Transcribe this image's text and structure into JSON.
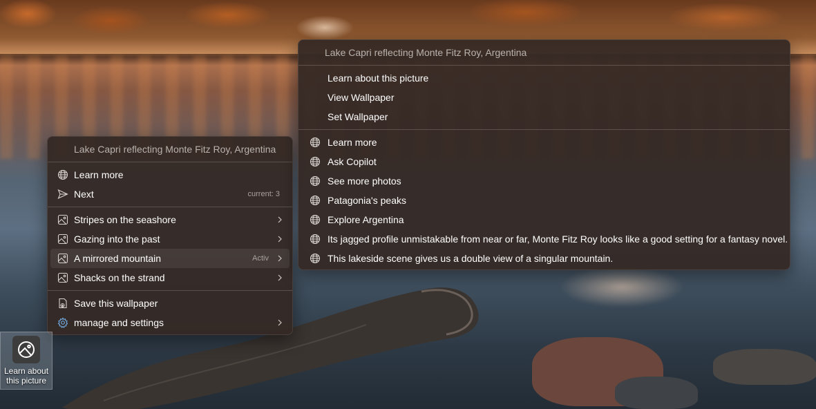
{
  "left_menu": {
    "header": "Lake Capri reflecting Monte Fitz Roy, Argentina",
    "group1": [
      {
        "label": "Learn more",
        "icon": "globe-icon"
      },
      {
        "label": "Next",
        "icon": "send-icon",
        "meta": "current: 3"
      }
    ],
    "group2": [
      {
        "label": "Stripes on the seashore",
        "icon": "image-icon"
      },
      {
        "label": "Gazing into the past",
        "icon": "image-icon"
      },
      {
        "label": "A mirrored mountain",
        "icon": "image-icon",
        "meta": "Activ"
      },
      {
        "label": "Shacks on the strand",
        "icon": "image-icon"
      }
    ],
    "group3": [
      {
        "label": "Save this wallpaper",
        "icon": "save-image-icon"
      },
      {
        "label": "manage and settings",
        "icon": "gear-icon"
      }
    ]
  },
  "right_menu": {
    "header": "Lake Capri reflecting Monte Fitz Roy, Argentina",
    "group1": [
      {
        "label": "Learn about this picture"
      },
      {
        "label": "View Wallpaper"
      },
      {
        "label": "Set Wallpaper"
      }
    ],
    "group2": [
      {
        "label": "Learn more",
        "icon": "globe-icon"
      },
      {
        "label": "Ask Copilot",
        "icon": "globe-icon"
      },
      {
        "label": "See more photos",
        "icon": "globe-icon"
      },
      {
        "label": "Patagonia's peaks",
        "icon": "globe-icon"
      },
      {
        "label": "Explore Argentina",
        "icon": "globe-icon"
      },
      {
        "label": "Its jagged profile unmistakable from near or far, Monte Fitz Roy looks like a good setting for a fantasy novel.",
        "icon": "globe-icon"
      },
      {
        "label": "This lakeside scene gives us a double view of a singular mountain.",
        "icon": "globe-icon"
      }
    ]
  },
  "desktop_icon": {
    "label_line1": "Learn about",
    "label_line2": "this picture"
  }
}
